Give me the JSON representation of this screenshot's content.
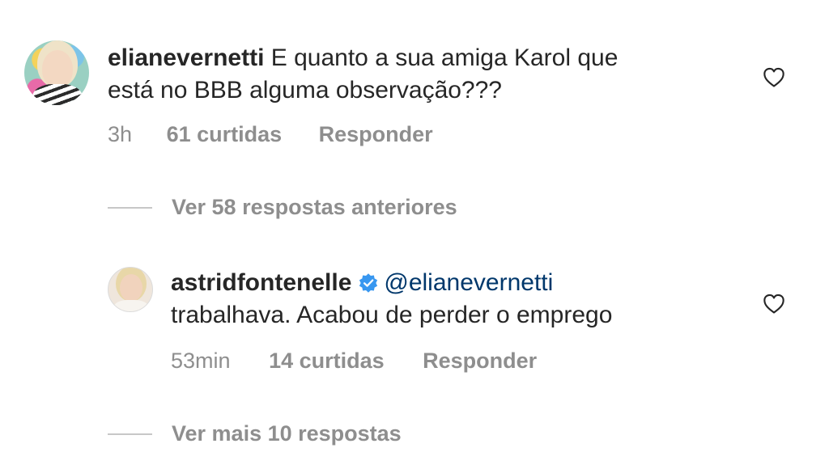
{
  "comments": [
    {
      "username": "elianevernetti",
      "text_line1": "E quanto a sua amiga Karol que",
      "text_line2": "está no BBB alguma observação???",
      "time": "3h",
      "likes": "61 curtidas",
      "reply_label": "Responder",
      "verified": false
    },
    {
      "username": "astridfontenelle",
      "mention": "@elianevernetti",
      "text_line1": "",
      "text_line2": "trabalhava. Acabou de perder o emprego",
      "time": "53min",
      "likes": "14 curtidas",
      "reply_label": "Responder",
      "verified": true
    }
  ],
  "replies": {
    "previous_label": "Ver 58 respostas anteriores",
    "more_label": "Ver mais 10 respostas"
  },
  "icons": {
    "like": "heart-outline-icon",
    "verified": "verified-badge-icon"
  },
  "colors": {
    "text": "#262626",
    "meta": "#8e8e8e",
    "mention": "#00376b",
    "verified": "#3897f0"
  }
}
